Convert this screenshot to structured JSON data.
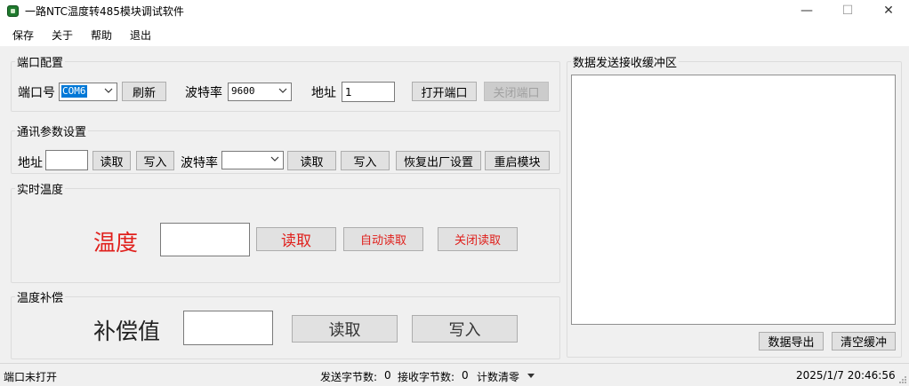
{
  "window": {
    "title": "一路NTC温度转485模块调试软件",
    "minimize": "—",
    "maximize": "☐",
    "close": "✕"
  },
  "menu": [
    "保存",
    "关于",
    "帮助",
    "退出"
  ],
  "port_config": {
    "legend": "端口配置",
    "port_label": "端口号",
    "port_value": "COM6",
    "refresh": "刷新",
    "baud_label": "波特率",
    "baud_value": "9600",
    "addr_label": "地址",
    "addr_value": "1",
    "open_port": "打开端口",
    "close_port": "关闭端口"
  },
  "comm_params": {
    "legend": "通讯参数设置",
    "addr_label": "地址",
    "addr_value": "",
    "read1": "读取",
    "write1": "写入",
    "baud_label": "波特率",
    "baud_value": "",
    "read2": "读取",
    "write2": "写入",
    "factory_reset": "恢复出厂设置",
    "restart": "重启模块"
  },
  "realtime": {
    "legend": "实时温度",
    "temp_label": "温度",
    "temp_value": "",
    "read": "读取",
    "auto_read": "自动读取",
    "stop_read": "关闭读取"
  },
  "compensation": {
    "legend": "温度补偿",
    "value_label": "补偿值",
    "value": "",
    "read": "读取",
    "write": "写入"
  },
  "buffer": {
    "legend": "数据发送接收缓冲区",
    "content": "",
    "export": "数据导出",
    "clear": "清空缓冲"
  },
  "status": {
    "port_state": "端口未打开",
    "sent_label": "发送字节数:",
    "sent_value": "0",
    "recv_label": "接收字节数:",
    "recv_value": "0",
    "reset_counts": "计数清零",
    "datetime": "2025/1/7 20:46:56"
  },
  "colors": {
    "accent_red": "#e0201c",
    "selection_blue": "#0078d7",
    "panel_bg": "#f0f0f0"
  }
}
